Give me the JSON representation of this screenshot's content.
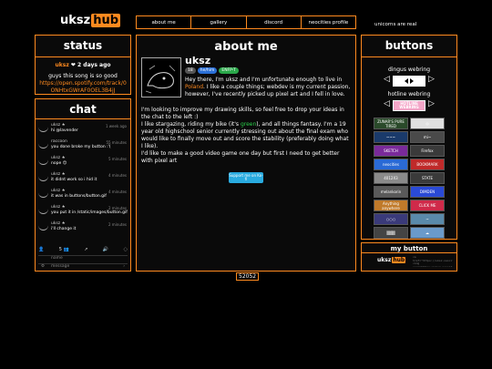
{
  "logo": {
    "prefix": "uksz",
    "suffix": "hub"
  },
  "nav": [
    "about me",
    "gallery",
    "discord",
    "neocities profile"
  ],
  "tagline": "unicorns are real",
  "status": {
    "title": "status",
    "user": "uksz",
    "heart": "❤",
    "ago": "2 days ago",
    "text": "guys this song is so good",
    "link": "https://open.spotify.com/track/0ONHtxGWrAF0OEL3B4jJ"
  },
  "chat": {
    "title": "chat",
    "messages": [
      {
        "name": "uksz ★",
        "time": "1 week ago",
        "text": "hi @lavender"
      },
      {
        "name": "raccoon",
        "time": "55 minutes",
        "text": "you done broke my button :'("
      },
      {
        "name": "uksz ★",
        "time": "5 minutes",
        "text": "nope 😊"
      },
      {
        "name": "uksz ★",
        "time": "4 minutes",
        "text": "it didnt work so i hid it"
      },
      {
        "name": "uksz ★",
        "time": "4 minutes",
        "text": "it was in buttons/button.gif"
      },
      {
        "name": "uksz ★",
        "time": "2 minutes",
        "text": "you put it in /static/images/button.gif"
      },
      {
        "name": "uksz ★",
        "time": "2 minutes",
        "text": "i'll change it"
      }
    ],
    "toolbar": [
      "👤",
      "5 👥",
      "↗",
      "🔊",
      "◌"
    ],
    "name_placeholder": "name",
    "message_placeholder": "message",
    "settings_icon": "⚙",
    "send_icon": "›"
  },
  "about": {
    "title": "about me",
    "username": "uksz",
    "tags": [
      {
        "label": "18",
        "color": "#555555"
      },
      {
        "label": "he/him",
        "color": "#2a6fd6"
      },
      {
        "label": "ENFP-T",
        "color": "#2aa84a"
      }
    ],
    "bio_part1": "Hey there, I'm uksz and I'm unfortunate enough to live in ",
    "bio_country": "Poland",
    "bio_part2": ". I like a couple things; webdev is my current passion, however, I've recently picked up pixel art and I fell in love.",
    "bio_para2": "I'm looking to improve my drawing skills, so feel free to drop your ideas in the chat to the left :)",
    "bio_para3a": "I like stargazing, riding my bike (it's ",
    "bio_green": "green",
    "bio_para3b": "), and all things fantasy. I'm a 19 year old highschool senior currently stressing out about the final exam who would like to finally move out and score the stability (preferably doing what I like).",
    "bio_para4": "I'd like to make a good video game one day but first I need to get better with pixel art",
    "kofi": "Support me on Ko-fi"
  },
  "buttons": {
    "title": "buttons",
    "webring1": "dingus webring",
    "webring2": "hotline webring",
    "webring2_label": "HOTLINE WEBRING",
    "grid": [
      {
        "label": "ZUNAR'S PURE TIRED",
        "bg": "#2a4a2a"
      },
      {
        "label": "◎",
        "bg": "#e0e0e0"
      },
      {
        "label": "~~~",
        "bg": "#1a3a6a"
      },
      {
        "label": "mi~",
        "bg": "#4a4a4a"
      },
      {
        "label": "SKETCH",
        "bg": "#7a2a9a"
      },
      {
        "label": "Firefox",
        "bg": "#3a3a3a"
      },
      {
        "label": "neocities",
        "bg": "#2a6ad6"
      },
      {
        "label": "BOOKMARK",
        "bg": "#c02a2a"
      },
      {
        "label": "4012X3",
        "bg": "#8a8a8a"
      },
      {
        "label": "STATE",
        "bg": "#3a3a3a"
      },
      {
        "label": "melankorin",
        "bg": "#5a5a5a"
      },
      {
        "label": "DIMDEN",
        "bg": "#2a4ad6"
      },
      {
        "label": "Anything anywhere",
        "bg": "#c07a2a"
      },
      {
        "label": "CLICK ME",
        "bg": "#d02a4a"
      },
      {
        "label": "○○○",
        "bg": "#3a3a7a"
      },
      {
        "label": "~",
        "bg": "#5a8aaa"
      },
      {
        "label": "▒▒▒",
        "bg": "#444444"
      },
      {
        "label": "☁",
        "bg": "#6a9aca"
      }
    ]
  },
  "mybutton": {
    "title": "my button",
    "code": "<a href=\"https://uksz.neocities.org\"><img src=\"https://uksz.neocities.org/static/images/button.gif\"></a>"
  },
  "counter": "52052"
}
